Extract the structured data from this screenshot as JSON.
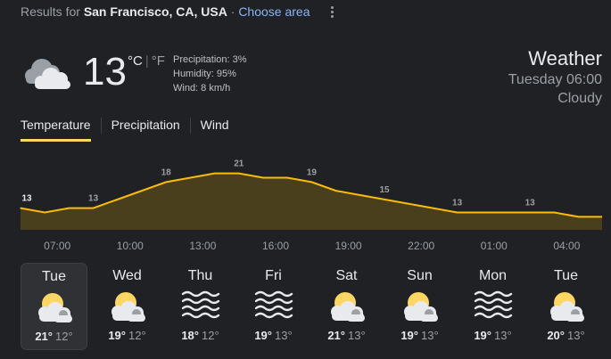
{
  "header": {
    "results_prefix": "Results for",
    "location": "San Francisco, CA, USA",
    "separator": "·",
    "choose_area": "Choose area"
  },
  "current": {
    "icon": "cloudy-icon",
    "temperature": "13",
    "unit_c": "°C",
    "unit_sep": "|",
    "unit_f": "°F",
    "precipitation": "Precipitation: 3%",
    "humidity": "Humidity: 95%",
    "wind": "Wind: 8 km/h"
  },
  "summary": {
    "title": "Weather",
    "datetime": "Tuesday 06:00",
    "condition": "Cloudy"
  },
  "tabs": [
    {
      "label": "Temperature",
      "active": true
    },
    {
      "label": "Precipitation",
      "active": false
    },
    {
      "label": "Wind",
      "active": false
    }
  ],
  "colors": {
    "accent": "#fdd663",
    "line": "#fbbc04",
    "fill": "#4a3f1c",
    "background": "#202124",
    "selected_card": "#303134"
  },
  "chart_data": {
    "type": "area",
    "x": [
      "06:00",
      "07:00",
      "08:00",
      "09:00",
      "10:00",
      "11:00",
      "12:00",
      "13:00",
      "14:00",
      "15:00",
      "16:00",
      "17:00",
      "18:00",
      "19:00",
      "20:00",
      "21:00",
      "22:00",
      "23:00",
      "00:00",
      "01:00",
      "02:00",
      "03:00",
      "04:00",
      "05:00"
    ],
    "values": [
      13,
      12,
      13,
      13,
      15,
      17,
      19,
      20,
      21,
      21,
      20,
      20,
      19,
      17,
      16,
      15,
      14,
      13,
      12,
      12,
      12,
      12,
      12,
      11
    ],
    "data_labels": [
      {
        "index": 0,
        "value": "13"
      },
      {
        "index": 3,
        "value": "13"
      },
      {
        "index": 6,
        "value": "18"
      },
      {
        "index": 9,
        "value": "21"
      },
      {
        "index": 12,
        "value": "19"
      },
      {
        "index": 15,
        "value": "15"
      },
      {
        "index": 18,
        "value": "13"
      },
      {
        "index": 21,
        "value": "13"
      }
    ],
    "tick_labels": [
      "07:00",
      "10:00",
      "13:00",
      "16:00",
      "19:00",
      "22:00",
      "01:00",
      "04:00"
    ],
    "ylim": [
      8,
      24
    ],
    "grid": false
  },
  "forecast": [
    {
      "day": "Tue",
      "icon": "partly-cloudy-icon",
      "high": "21°",
      "low": "12°",
      "selected": true
    },
    {
      "day": "Wed",
      "icon": "partly-cloudy-icon",
      "high": "19°",
      "low": "12°",
      "selected": false
    },
    {
      "day": "Thu",
      "icon": "fog-icon",
      "high": "18°",
      "low": "12°",
      "selected": false
    },
    {
      "day": "Fri",
      "icon": "fog-icon",
      "high": "19°",
      "low": "13°",
      "selected": false
    },
    {
      "day": "Sat",
      "icon": "partly-cloudy-icon",
      "high": "21°",
      "low": "13°",
      "selected": false
    },
    {
      "day": "Sun",
      "icon": "partly-cloudy-icon",
      "high": "19°",
      "low": "13°",
      "selected": false
    },
    {
      "day": "Mon",
      "icon": "fog-icon",
      "high": "19°",
      "low": "13°",
      "selected": false
    },
    {
      "day": "Tue",
      "icon": "partly-cloudy-icon",
      "high": "20°",
      "low": "13°",
      "selected": false
    }
  ]
}
